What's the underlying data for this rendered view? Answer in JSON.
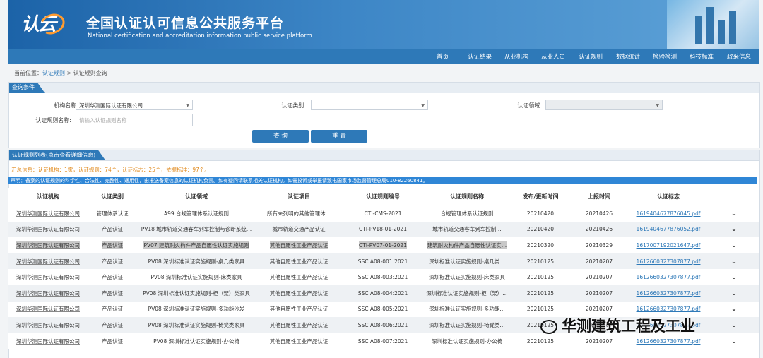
{
  "header": {
    "top_note": "…",
    "logo_text": "认云",
    "title_cn": "全国认证认可信息公共服务平台",
    "title_en": "National certification and accreditation information public service platform"
  },
  "nav": [
    "首页",
    "认证结果",
    "从业机构",
    "从业人员",
    "认证规则",
    "数据统计",
    "检验检测",
    "科技标准",
    "政采信息"
  ],
  "breadcrumb": {
    "prefix": "当前位置：",
    "link": "认证规则",
    "sep": " > ",
    "current": "认证规则查询"
  },
  "query": {
    "title": "查询条件",
    "org_label": "机构名称:",
    "org_value": "深圳华测国际认证有限公司",
    "category_label": "认证类别:",
    "category_value": "",
    "field_label": "认证领域:",
    "field_value": "",
    "rule_name_label": "认证规则名称:",
    "rule_name_placeholder": "请输入认证规则名称",
    "search_btn": "查 询",
    "reset_btn": "重 置"
  },
  "results": {
    "title": "认证规则列表(点击查看详细信息)",
    "summary": "汇总信息：认证机构：1家，认证规则：74个，认证标志：25个，依据标准：97个。",
    "notice": "声明：备案的认证规则的科学性、合法性、完整性、适用性，由报送备案信息的认证机构负责。如有疑问请联系相关认证机构。如需投诉或举报请致电国家市场监督管理总局010-82260841。",
    "columns": [
      "认证机构",
      "认证类别",
      "认证领域",
      "认证项目",
      "认证规则编号",
      "认证规则名称",
      "发布/更新时间",
      "上报时间",
      "认证标志"
    ],
    "rows": [
      [
        "深圳华测国际认证有限公司",
        "管理体系认证",
        "A99 合规管理体系认证规则",
        "所有未列明的其他管理体…",
        "CTI-CMS-2021",
        "合规管理体系认证规则",
        "20210420",
        "20210426",
        "1619404677876045.pdf"
      ],
      [
        "深圳华测国际认证有限公司",
        "产品认证",
        "PV18 城市轨道交通客车列车控制与诊断系统…",
        "城市轨道交通产品认证",
        "CTI-PV18-01-2021",
        "城市轨道交通客车列车控制…",
        "20210420",
        "20210426",
        "1619404677876052.pdf"
      ],
      [
        "深圳华测国际认证有限公司",
        "产品认证",
        "PV07 建筑耐火构件产品自愿性认证实施规则",
        "其他自愿性工业产品认证",
        "CTI-PV07-01-2021",
        "建筑耐火构件产品自愿性认证实…",
        "20210320",
        "20210329",
        "1617007192021647.pdf"
      ],
      [
        "深圳华测国际认证有限公司",
        "产品认证",
        "PV08 深圳标准认证实施规则-桌几类家具",
        "其他自愿性工业产品认证",
        "SSC A08-001:2021",
        "深圳标准认证实施规则-桌几类…",
        "20210125",
        "20210207",
        "1612660327307877.pdf"
      ],
      [
        "深圳华测国际认证有限公司",
        "产品认证",
        "PV08 深圳标准认证实施规则-床类家具",
        "其他自愿性工业产品认证",
        "SSC A08-003:2021",
        "深圳标准认证实施规则-床类家具",
        "20210125",
        "20210207",
        "1612660327307877.pdf"
      ],
      [
        "深圳华测国际认证有限公司",
        "产品认证",
        "PV08 深圳标准认证实施规则-柜（架）类家具",
        "其他自愿性工业产品认证",
        "SSC A08-004:2021",
        "深圳标准认证实施规则-柜（架）…",
        "20210125",
        "20210207",
        "1612660327307877.pdf"
      ],
      [
        "深圳华测国际认证有限公司",
        "产品认证",
        "PV08 深圳标准认证实施规则-多功能沙发",
        "其他自愿性工业产品认证",
        "SSC A08-005:2021",
        "深圳标准认证实施规则-多功能…",
        "20210125",
        "20210207",
        "1612660327307877.pdf"
      ],
      [
        "深圳华测国际认证有限公司",
        "产品认证",
        "PV08 深圳标准认证实施规则-椅凳类家具",
        "其他自愿性工业产品认证",
        "SSC A08-006:2021",
        "深圳标准认证实施规则-椅凳类…",
        "20210125",
        "20210207",
        "1612660327307877.pdf"
      ],
      [
        "深圳华测国际认证有限公司",
        "产品认证",
        "PV08 深圳标准认证实施规则-办公椅",
        "其他自愿性工业产品认证",
        "SSC A08-007:2021",
        "深圳标准认证实施规则-办公椅",
        "20210125",
        "20210207",
        "1612660327307877.pdf"
      ]
    ],
    "highlight_row": 2
  },
  "watermark": "华测建筑工程及工业",
  "colors": {
    "brand_blue": "#2e79b8",
    "summary_orange": "#e08a1e",
    "notice_blue": "#2f86d6"
  }
}
